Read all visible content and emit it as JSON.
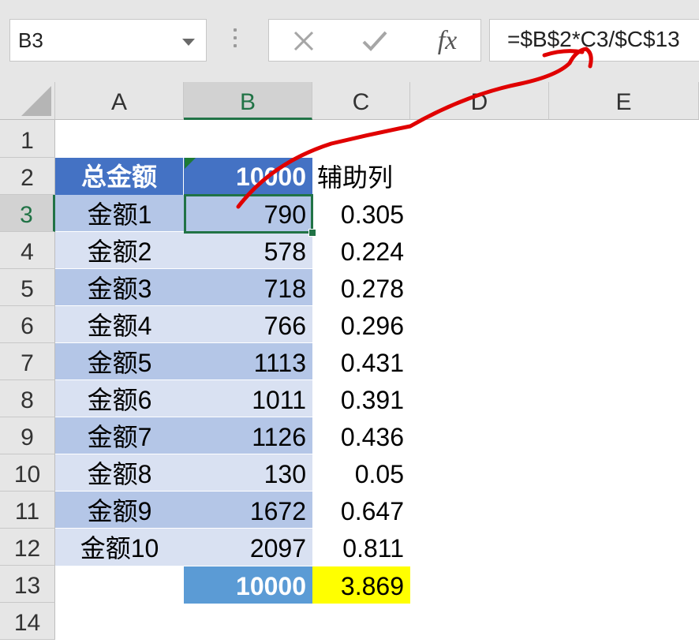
{
  "name_box": "B3",
  "formula": "=$B$2*C3/$C$13",
  "fx_label": "fx",
  "icons": {
    "cancel": "cross-icon",
    "enter": "check-icon",
    "function": "fx-icon",
    "dropdown": "chevron-down-icon"
  },
  "columns": [
    "A",
    "B",
    "C",
    "D",
    "E"
  ],
  "rows": [
    "1",
    "2",
    "3",
    "4",
    "5",
    "6",
    "7",
    "8",
    "9",
    "10",
    "11",
    "12",
    "13",
    "14"
  ],
  "header_row": {
    "a": "总金额",
    "b": "10000",
    "c": "辅助列"
  },
  "data_rows": [
    {
      "a": "金额1",
      "b": "790",
      "c": "0.305"
    },
    {
      "a": "金额2",
      "b": "578",
      "c": "0.224"
    },
    {
      "a": "金额3",
      "b": "718",
      "c": "0.278"
    },
    {
      "a": "金额4",
      "b": "766",
      "c": "0.296"
    },
    {
      "a": "金额5",
      "b": "1113",
      "c": "0.431"
    },
    {
      "a": "金额6",
      "b": "1011",
      "c": "0.391"
    },
    {
      "a": "金额7",
      "b": "1126",
      "c": "0.436"
    },
    {
      "a": "金额8",
      "b": "130",
      "c": "0.05"
    },
    {
      "a": "金额9",
      "b": "1672",
      "c": "0.647"
    },
    {
      "a": "金额10",
      "b": "2097",
      "c": "0.811"
    }
  ],
  "total_row": {
    "b": "10000",
    "c": "3.869"
  },
  "colors": {
    "header_fill": "#4472c4",
    "band_dark": "#b4c6e7",
    "band_light": "#d9e1f2",
    "total_fill": "#5b9bd5",
    "highlight": "#ffff00",
    "selection": "#217346",
    "annotation": "#e00000"
  }
}
